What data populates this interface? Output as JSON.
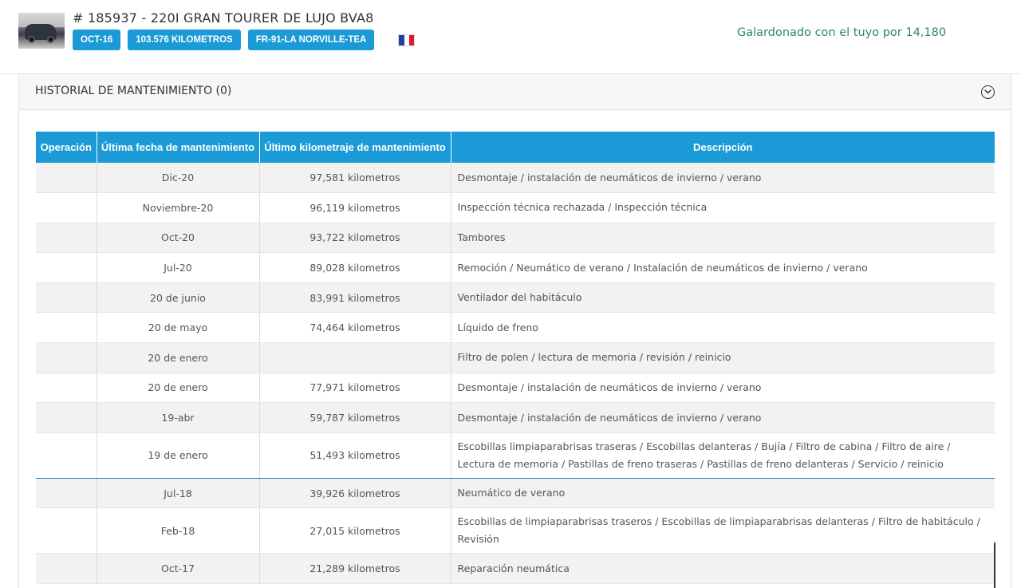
{
  "header": {
    "title": "# 185937 - 220I GRAN TOURER DE LUJO BVA8",
    "badges": [
      "OCT-16",
      "103.576 KILOMETROS",
      "FR-91-LA NORVILLE-TEA"
    ],
    "award": "Galardonado con el tuyo por 14,180",
    "flag_colors": [
      "#1f3fa3",
      "#ffffff",
      "#e2182c"
    ],
    "accent_color": "#1a9ad6",
    "award_color": "#2e8b57"
  },
  "panel": {
    "title": "HISTORIAL DE MANTENIMIENTO (0)",
    "toggle_icon": "chevron-down-circle-icon"
  },
  "table": {
    "columns": [
      "Operación",
      "Última fecha de mantenimiento",
      "Último kilometraje de mantenimiento",
      "Descripción"
    ],
    "rows": [
      {
        "op": "",
        "date": "Dic-20",
        "km": "97,581 kilometros",
        "desc": "Desmontaje / instalación de neumáticos de invierno / verano"
      },
      {
        "op": "",
        "date": "Noviembre-20",
        "km": "96,119 kilometros",
        "desc": "Inspección técnica rechazada / Inspección técnica"
      },
      {
        "op": "",
        "date": "Oct-20",
        "km": "93,722 kilometros",
        "desc": "Tambores"
      },
      {
        "op": "",
        "date": "Jul-20",
        "km": "89,028 kilometros",
        "desc": "Remoción / Neumático de verano / Instalación de neumáticos de invierno / verano"
      },
      {
        "op": "",
        "date": "20 de junio",
        "km": "83,991 kilometros",
        "desc": "Ventilador del habitáculo"
      },
      {
        "op": "",
        "date": "20 de mayo",
        "km": "74,464 kilometros",
        "desc": "Líquido de freno"
      },
      {
        "op": "",
        "date": "20 de enero",
        "km": "",
        "desc": "Filtro de polen / lectura de memoria / revisión / reinicio"
      },
      {
        "op": "",
        "date": "20 de enero",
        "km": "77,971 kilometros",
        "desc": "Desmontaje / instalación de neumáticos de invierno / verano"
      },
      {
        "op": "",
        "date": "19-abr",
        "km": "59,787 kilometros",
        "desc": "Desmontaje / instalación de neumáticos de invierno / verano"
      },
      {
        "op": "",
        "date": "19 de enero",
        "km": "51,493 kilometros",
        "desc": "Escobillas limpiaparabrisas traseras / Escobillas delanteras / Bujía / Filtro de cabina / Filtro de aire / Lectura de memoria / Pastillas de freno traseras / Pastillas de freno delanteras / Servicio / reinicio"
      },
      {
        "op": "",
        "date": "Jul-18",
        "km": "39,926 kilometros",
        "desc": "Neumático de verano"
      },
      {
        "op": "",
        "date": "Feb-18",
        "km": "27,015 kilometros",
        "desc": "Escobillas de limpiaparabrisas traseros / Escobillas de limpiaparabrisas delanteras / Filtro de habitáculo / Revisión"
      },
      {
        "op": "",
        "date": "Oct-17",
        "km": "21,289 kilometros",
        "desc": "Reparación neumática"
      }
    ]
  }
}
